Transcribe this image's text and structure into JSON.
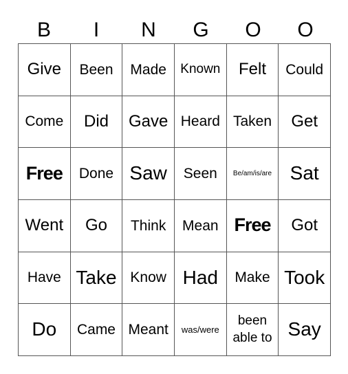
{
  "header": [
    "B",
    "I",
    "N",
    "G",
    "O",
    "O"
  ],
  "cells": [
    [
      "Give",
      "Been",
      "Made",
      "Known",
      "Felt",
      "Could"
    ],
    [
      "Come",
      "Did",
      "Gave",
      "Heard",
      "Taken",
      "Get"
    ],
    [
      "Free",
      "Done",
      "Saw",
      "Seen",
      "Be/am/is/are",
      "Sat"
    ],
    [
      "Went",
      "Go",
      "Think",
      "Mean",
      "Free",
      "Got"
    ],
    [
      "Have",
      "Take",
      "Know",
      "Had",
      "Make",
      "Took"
    ],
    [
      "Do",
      "Came",
      "Meant",
      "was/were",
      "been able to",
      "Say"
    ]
  ]
}
